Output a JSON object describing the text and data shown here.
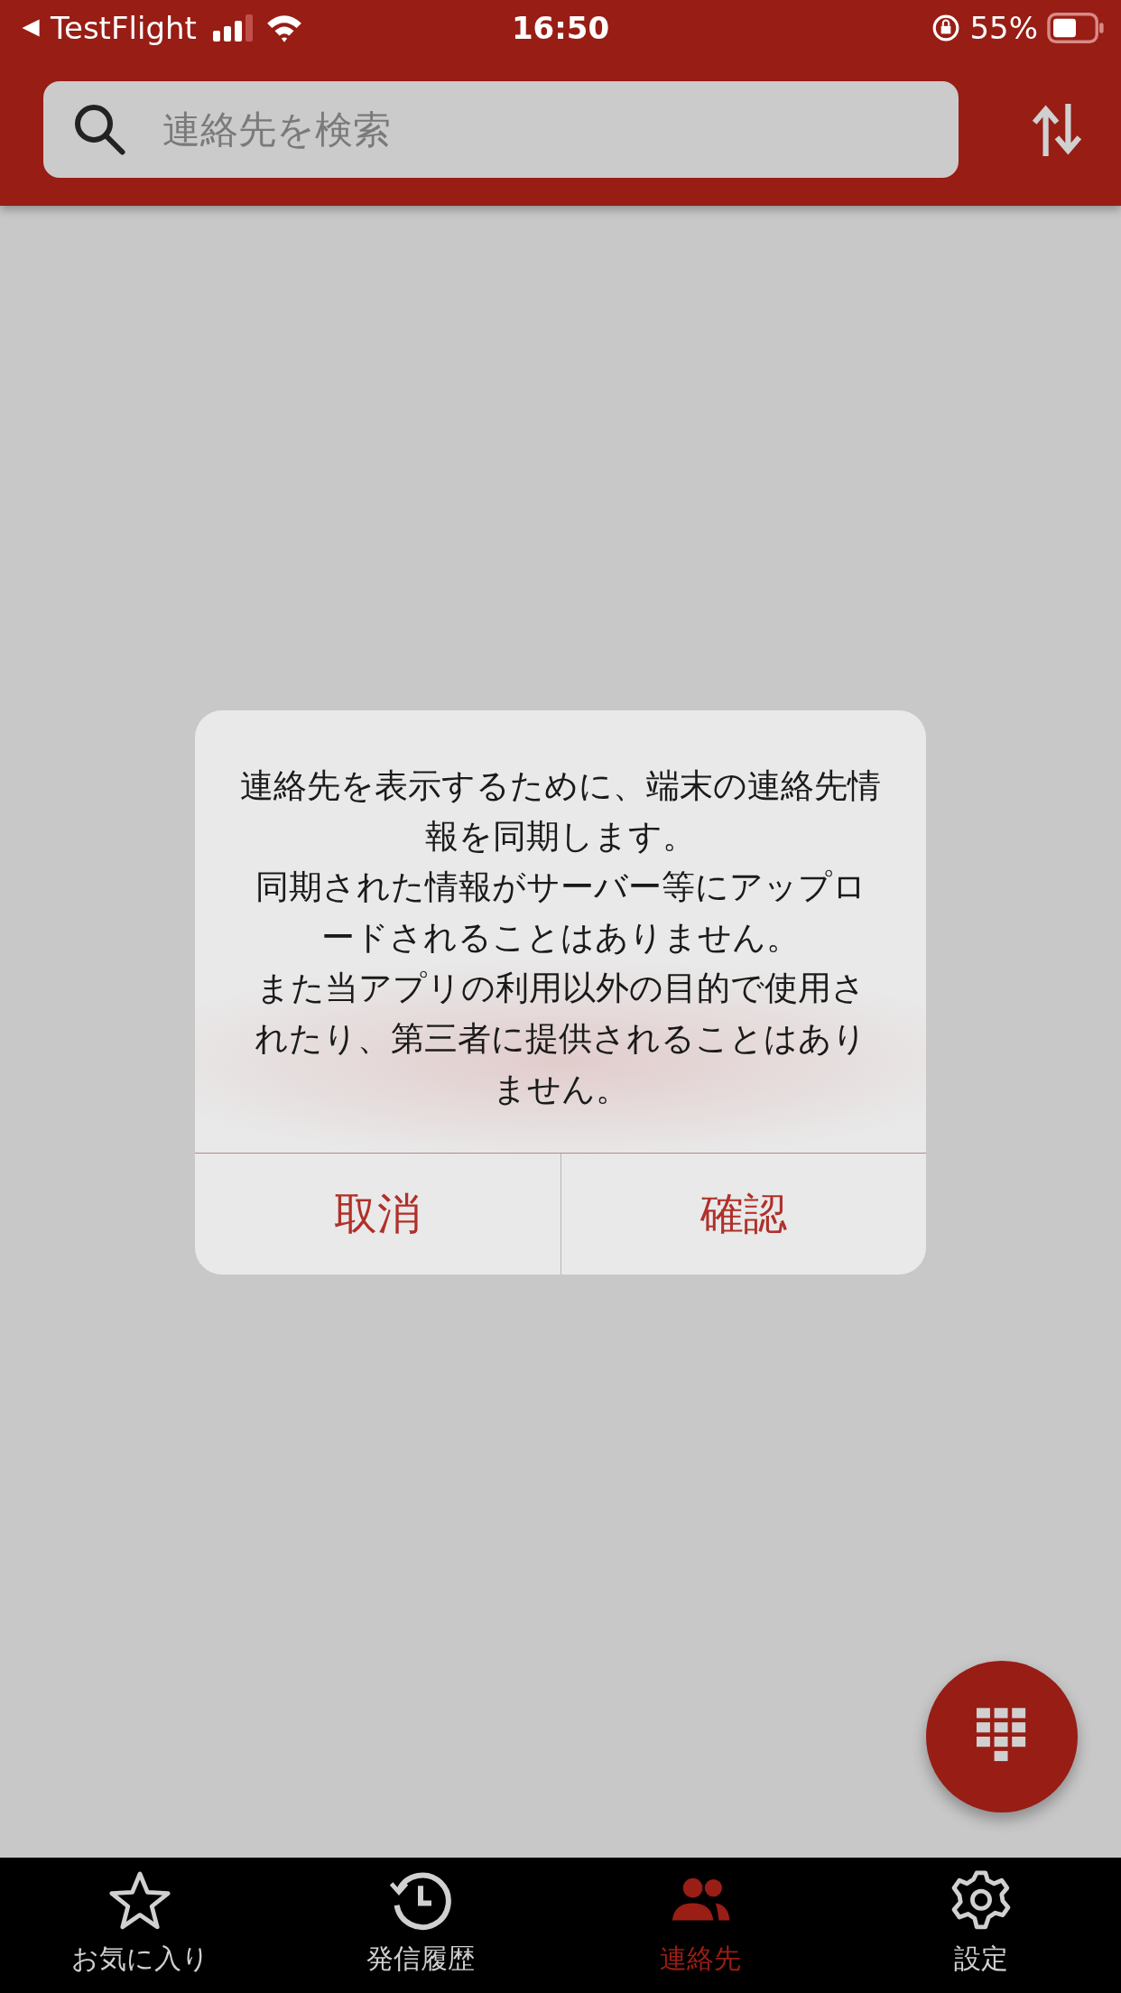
{
  "status_bar": {
    "back_label": "TestFlight",
    "time": "16:50",
    "battery_percent": "55%"
  },
  "search": {
    "placeholder": "連絡先を検索"
  },
  "dialog": {
    "paragraphs": [
      "連絡先を表示するために、端末の連絡先情報を同期します。",
      "同期された情報がサーバー等にアップロードされることはありません。",
      "また当アプリの利用以外の目的で使用されたり、第三者に提供されることはありません。"
    ],
    "buttons": [
      "取消",
      "確認"
    ]
  },
  "tabs": [
    {
      "kind": "star",
      "label": "お気に入り",
      "selected": false
    },
    {
      "kind": "history",
      "label": "発信履歴",
      "selected": false
    },
    {
      "kind": "contacts",
      "label": "連絡先",
      "selected": true
    },
    {
      "kind": "settings",
      "label": "設定",
      "selected": false
    }
  ]
}
